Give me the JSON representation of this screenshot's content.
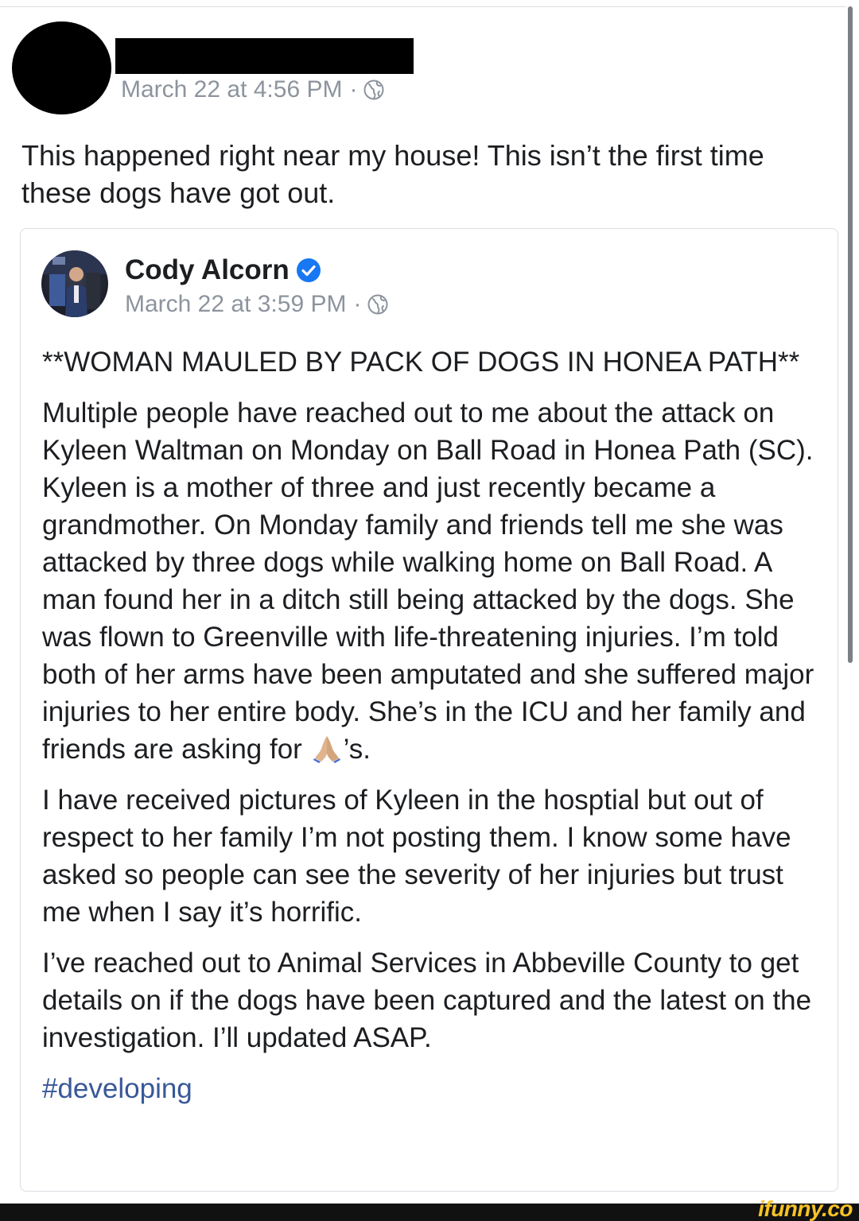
{
  "post": {
    "timestamp": "March 22 at 4:56 PM",
    "separator": "·",
    "privacy_icon": "globe-icon",
    "text": "This happened right near my house! This isn’t the first time these dogs have got out."
  },
  "shared_post": {
    "author": "Cody Alcorn",
    "verified_icon": "verified-badge-icon",
    "timestamp": "March 22 at 3:59 PM",
    "separator": "·",
    "privacy_icon": "globe-icon",
    "headline": "**WOMAN MAULED BY PACK OF DOGS IN HONEA PATH**",
    "paragraph_1_before_emoji": "Multiple people have reached out to me about the attack on Kyleen Waltman on Monday on Ball Road in Honea Path (SC). Kyleen is a mother of three and just recently became a grandmother. On Monday family and friends tell me she was attacked by three dogs while walking home on Ball Road. A man found her in a ditch still being attacked by the dogs. She was flown to Greenville with life-threatening injuries. I’m told both of her arms have been amputated and she suffered major injuries to her entire body. She’s in the ICU and her family and friends are asking for",
    "paragraph_1_emoji": "folded-hands-icon",
    "paragraph_1_after_emoji": "’s.",
    "paragraph_2": "I have received pictures of Kyleen in the hosptial but out of respect to her family I’m not posting them. I know some have asked so people can see the severity of her injuries but trust me when I say it’s horrific.",
    "paragraph_3": "I’ve reached out to Animal Services in Abbeville County to get details on if the dogs have been captured and the latest on the investigation. I’ll updated ASAP.",
    "hashtag": "#developing"
  },
  "watermark": "ifunny.co",
  "colors": {
    "text": "#1c1e21",
    "meta": "#8d949e",
    "link": "#385898",
    "verified": "#1877f2",
    "watermark": "#f7c325"
  }
}
